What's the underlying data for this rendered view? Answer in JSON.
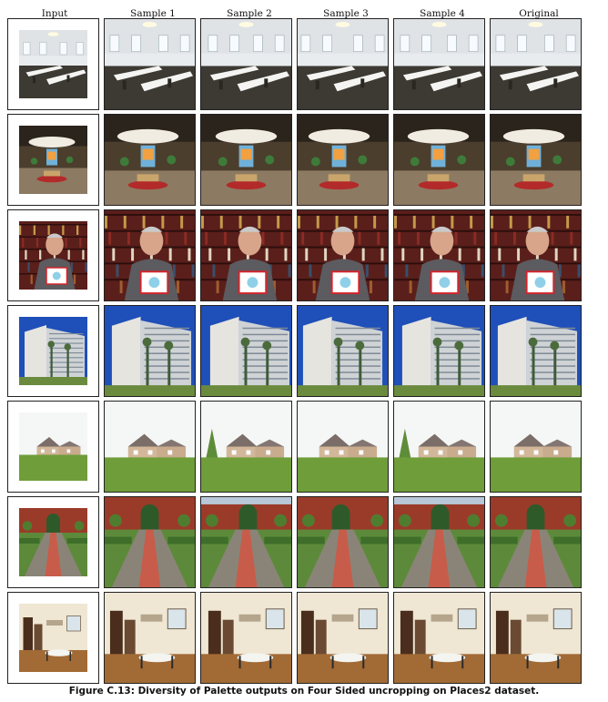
{
  "column_headers": [
    "Input",
    "Sample 1",
    "Sample 2",
    "Sample 3",
    "Sample 4",
    "Original"
  ],
  "rows": [
    {
      "scene": "classroom"
    },
    {
      "scene": "mall-atrium"
    },
    {
      "scene": "man-bookshelf"
    },
    {
      "scene": "hotel-building"
    },
    {
      "scene": "house-lawn"
    },
    {
      "scene": "brick-garden-path"
    },
    {
      "scene": "dining-room"
    }
  ],
  "caption": "Figure C.13: Diversity of Palette outputs on Four Sided uncropping on Places2 dataset.",
  "colors": {
    "border": "#222222",
    "sky_blue": "#1f4fb8",
    "grass": "#6f9d3a",
    "brick": "#9a3b2a",
    "wood_floor": "#a26a35"
  }
}
